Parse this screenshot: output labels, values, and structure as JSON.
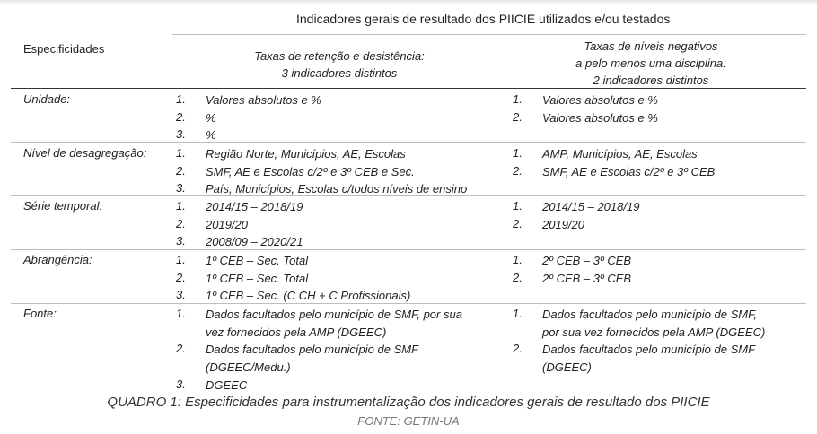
{
  "header": {
    "title": "Indicadores gerais de resultado dos PIICIE utilizados e/ou testados",
    "spec_label": "Especificidades",
    "col_a": [
      "Taxas de retenção e desistência:",
      "3 indicadores distintos"
    ],
    "col_b": [
      "Taxas de níveis negativos",
      "a pelo menos uma disciplina:",
      "2 indicadores distintos"
    ]
  },
  "rows": [
    {
      "label": "Unidade:",
      "a": [
        {
          "num": "1.",
          "lines": [
            "Valores absolutos e %"
          ]
        },
        {
          "num": "2.",
          "lines": [
            "%"
          ]
        },
        {
          "num": "3.",
          "lines": [
            "%"
          ]
        }
      ],
      "b": [
        {
          "num": "1.",
          "lines": [
            "Valores absolutos e %"
          ]
        },
        {
          "num": "2.",
          "lines": [
            "Valores absolutos e %"
          ]
        }
      ]
    },
    {
      "label": "Nível de desagregação:",
      "a": [
        {
          "num": "1.",
          "lines": [
            "Região Norte, Municípios, AE, Escolas"
          ]
        },
        {
          "num": "2.",
          "lines": [
            "SMF, AE e Escolas c/2º e 3º CEB e Sec."
          ]
        },
        {
          "num": "3.",
          "lines": [
            "País, Municípios, Escolas c/todos níveis de ensino"
          ]
        }
      ],
      "b": [
        {
          "num": "1.",
          "lines": [
            "AMP, Municípios, AE, Escolas"
          ]
        },
        {
          "num": "2.",
          "lines": [
            "SMF, AE e Escolas c/2º e 3º CEB"
          ]
        }
      ]
    },
    {
      "label": "Série temporal:",
      "a": [
        {
          "num": "1.",
          "lines": [
            "2014/15 – 2018/19"
          ]
        },
        {
          "num": "2.",
          "lines": [
            "2019/20"
          ]
        },
        {
          "num": "3.",
          "lines": [
            "2008/09 – 2020/21"
          ]
        }
      ],
      "b": [
        {
          "num": "1.",
          "lines": [
            "2014/15 – 2018/19"
          ]
        },
        {
          "num": "2.",
          "lines": [
            "2019/20"
          ]
        }
      ]
    },
    {
      "label": "Abrangência:",
      "a": [
        {
          "num": "1.",
          "lines": [
            "1º CEB – Sec. Total"
          ]
        },
        {
          "num": "2.",
          "lines": [
            "1º CEB – Sec. Total"
          ]
        },
        {
          "num": "3.",
          "lines": [
            "1º CEB – Sec. (C CH + C Profissionais)"
          ]
        }
      ],
      "b": [
        {
          "num": "1.",
          "lines": [
            "2º CEB – 3º CEB"
          ]
        },
        {
          "num": "2.",
          "lines": [
            "2º CEB – 3º CEB"
          ]
        }
      ]
    },
    {
      "label": "Fonte:",
      "a": [
        {
          "num": "1.",
          "lines": [
            "Dados facultados pelo município de SMF, por sua",
            "vez fornecidos pela AMP (DGEEC)"
          ]
        },
        {
          "num": "2.",
          "lines": [
            "Dados facultados pelo município de SMF",
            "(DGEEC/Medu.)"
          ]
        },
        {
          "num": "3.",
          "lines": [
            "DGEEC"
          ]
        }
      ],
      "b": [
        {
          "num": "1.",
          "lines": [
            "Dados facultados pelo município de SMF,",
            "por sua vez fornecidos pela AMP (DGEEC)"
          ]
        },
        {
          "num": "2.",
          "lines": [
            "Dados facultados pelo município de SMF",
            "(DGEEC)"
          ]
        }
      ]
    }
  ],
  "caption": "QUADRO 1: Especificidades para instrumentalização dos indicadores gerais de resultado dos PIICIE",
  "source": "FONTE: GETIN-UA"
}
